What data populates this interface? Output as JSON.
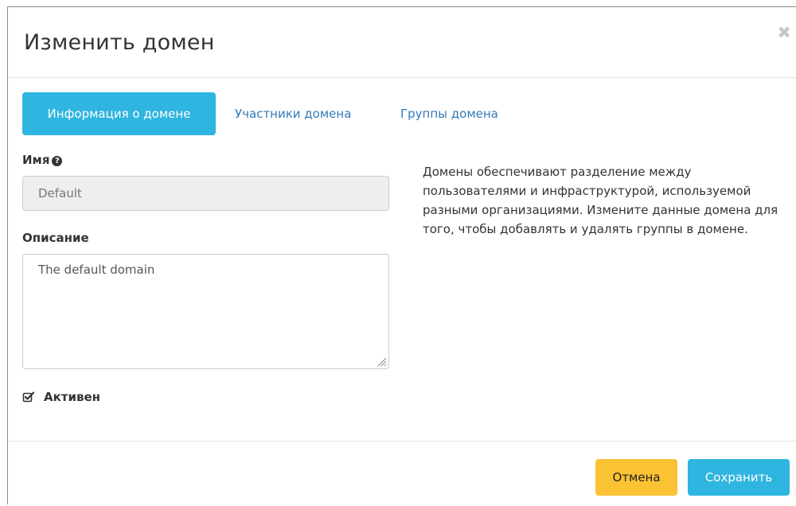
{
  "modal": {
    "title": "Изменить домен",
    "close_glyph": "✖"
  },
  "tabs": [
    {
      "label": "Информация о домене",
      "active": true
    },
    {
      "label": "Участники домена",
      "active": false
    },
    {
      "label": "Группы домена",
      "active": false
    }
  ],
  "form": {
    "name_label": "Имя",
    "name_help_glyph": "?",
    "name_value": "Default",
    "description_label": "Описание",
    "description_value": "The default domain",
    "enabled_label": "Активен",
    "enabled_checked": true
  },
  "help_text": "Домены обеспечивают разделение между пользователями и инфраструктурой, используемой разными организациями. Измените данные домена для того, чтобы добавлять и удалять группы в домене.",
  "footer": {
    "cancel_label": "Отмена",
    "save_label": "Сохранить"
  },
  "colors": {
    "primary": "#2eb5e0",
    "warning": "#fbc234",
    "link": "#337ab7"
  }
}
